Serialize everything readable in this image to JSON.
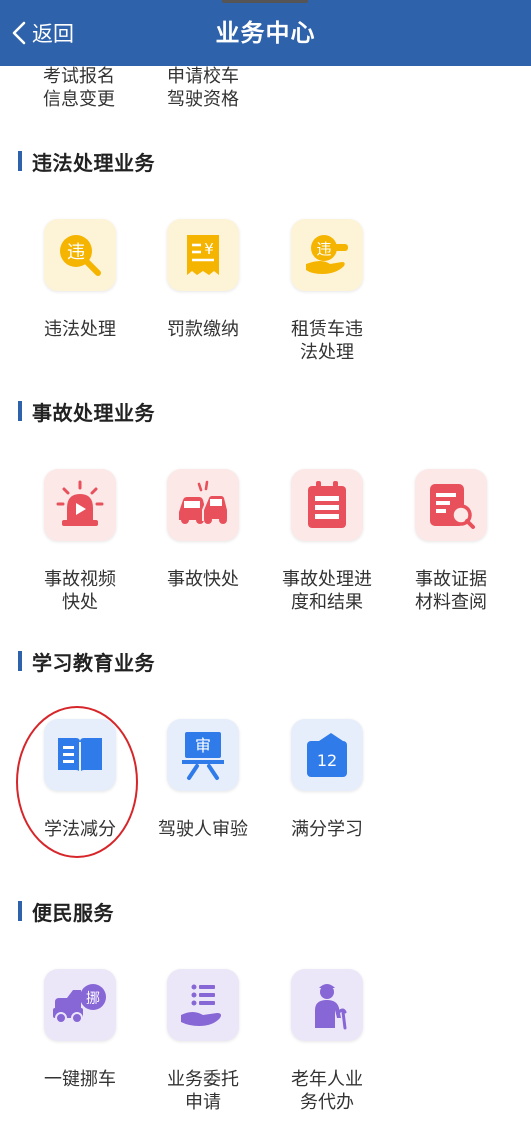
{
  "header": {
    "back_label": "返回",
    "title": "业务中心",
    "background": "#2e62ab"
  },
  "top_partial": [
    {
      "line1": "考试报名",
      "line2": "信息变更"
    },
    {
      "line1": "申请校车",
      "line2": "驾驶资格"
    }
  ],
  "sections": [
    {
      "title": "违法处理业务",
      "items": [
        {
          "line1": "违法处理",
          "line2": "",
          "icon": "violation-search-icon"
        },
        {
          "line1": "罚款缴纳",
          "line2": "",
          "icon": "fine-receipt-icon"
        },
        {
          "line1": "租赁车违",
          "line2": "法处理",
          "icon": "rental-violation-hand-icon"
        }
      ]
    },
    {
      "title": "事故处理业务",
      "items": [
        {
          "line1": "事故视频",
          "line2": "快处",
          "icon": "siren-video-icon"
        },
        {
          "line1": "事故快处",
          "line2": "",
          "icon": "car-collision-icon"
        },
        {
          "line1": "事故处理进",
          "line2": "度和结果",
          "icon": "clipboard-progress-icon"
        },
        {
          "line1": "事故证据",
          "line2": "材料查阅",
          "icon": "document-search-icon"
        }
      ]
    },
    {
      "title": "学习教育业务",
      "items": [
        {
          "line1": "学法减分",
          "line2": "",
          "icon": "open-book-icon"
        },
        {
          "line1": "驾驶人审验",
          "line2": "",
          "icon": "review-board-icon"
        },
        {
          "line1": "满分学习",
          "line2": "",
          "icon": "calendar-12-icon",
          "badge": "12"
        }
      ]
    },
    {
      "title": "便民服务",
      "items": [
        {
          "line1": "一键挪车",
          "line2": "",
          "icon": "move-car-icon",
          "badge": "挪"
        },
        {
          "line1": "业务委托",
          "line2": "申请",
          "icon": "hand-list-icon"
        },
        {
          "line1": "老年人业",
          "line2": "务代办",
          "icon": "elderly-person-icon"
        }
      ]
    }
  ],
  "icon_text": {
    "violation": "违",
    "fine": "¥",
    "review": "审"
  },
  "colors": {
    "accent_blue": "#2e62ab",
    "yellow": "#f5b400",
    "red": "#e8505b",
    "blue": "#2f7bea",
    "purple": "#8766d6",
    "highlight_ring": "#d7262a"
  }
}
